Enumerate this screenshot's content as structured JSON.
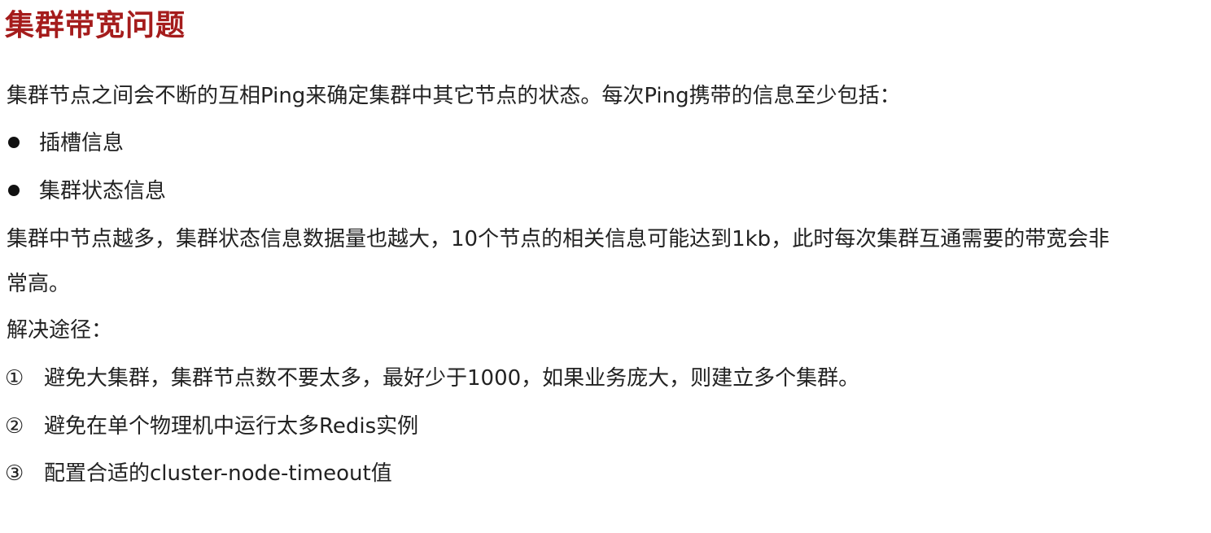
{
  "title": "集群带宽问题",
  "intro": "集群节点之间会不断的互相Ping来确定集群中其它节点的状态。每次Ping携带的信息至少包括：",
  "bullets": [
    "插槽信息",
    "集群状态信息"
  ],
  "paragraph_line1": "集群中节点越多，集群状态信息数据量也越大，10个节点的相关信息可能达到1kb，此时每次集群互通需要的带宽会非",
  "paragraph_line2": "常高。",
  "solutions_heading": "解决途径：",
  "steps": [
    {
      "marker": "①",
      "text": "避免大集群，集群节点数不要太多，最好少于1000，如果业务庞大，则建立多个集群。"
    },
    {
      "marker": "②",
      "text": "避免在单个物理机中运行太多Redis实例"
    },
    {
      "marker": "③",
      "text": "配置合适的cluster-node-timeout值"
    }
  ],
  "colors": {
    "title": "#a51c1c",
    "text": "#222222"
  }
}
